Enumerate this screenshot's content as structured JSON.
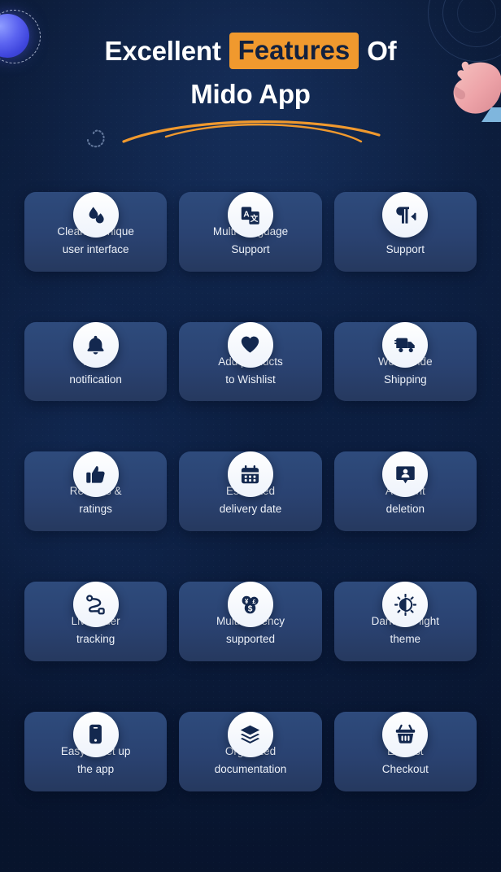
{
  "header": {
    "title_part1": "Excellent",
    "title_highlight": "Features",
    "title_part2": "Of",
    "title_line2": "Mido App"
  },
  "colors": {
    "background": "#0e2244",
    "card": "#2b4470",
    "accent_orange": "#F0992E",
    "icon_navy": "#13284f",
    "icon_badge": "#ffffff",
    "text": "#eef2f9",
    "sphere": "#5b63f0",
    "hand": "#f0a9ad",
    "sleeve": "#7fb6dd"
  },
  "decorations": [
    {
      "name": "sphere",
      "label": "blue-gradient-sphere"
    },
    {
      "name": "sphere-orbit-ring",
      "label": "dashed-orbit-circle"
    },
    {
      "name": "corner-rings",
      "label": "concentric-circles"
    },
    {
      "name": "swirl",
      "label": "dotted-comma-swirl"
    },
    {
      "name": "underline-arcs",
      "label": "orange-double-arc"
    },
    {
      "name": "hand",
      "label": "3d-hand-illustration"
    }
  ],
  "features": [
    {
      "icon": "droplet-icon",
      "label": "Clean & Unique\nuser interface"
    },
    {
      "icon": "translate-icon",
      "label": "Multi Language\nSupport"
    },
    {
      "icon": "rtl-direction-icon",
      "label": "RTL\nSupport"
    },
    {
      "icon": "bell-icon",
      "label": "Push\nnotification"
    },
    {
      "icon": "heart-icon",
      "label": "Add products\nto Wishlist"
    },
    {
      "icon": "delivery-truck-icon",
      "label": "World wide\nShipping"
    },
    {
      "icon": "thumbs-up-icon",
      "label": "Reviews &\nratings"
    },
    {
      "icon": "calendar-icon",
      "label": "Estimated\ndelivery date"
    },
    {
      "icon": "account-badge-icon",
      "label": "Account\ndeletion"
    },
    {
      "icon": "route-tracking-icon",
      "label": "Live order\ntracking"
    },
    {
      "icon": "currency-coins-icon",
      "label": "Multi currency\nsupported"
    },
    {
      "icon": "sun-moon-icon",
      "label": "Dark and light\ntheme"
    },
    {
      "icon": "mobile-phone-icon",
      "label": "Easy to set up\nthe app"
    },
    {
      "icon": "layers-icon",
      "label": "Organized\ndocumentation"
    },
    {
      "icon": "shopping-basket-icon",
      "label": "Easiest\nCheckout"
    }
  ]
}
